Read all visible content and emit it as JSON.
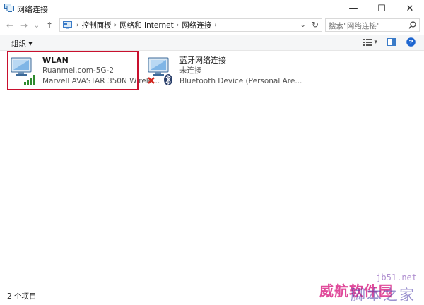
{
  "window": {
    "title": "网络连接",
    "minimize": "—",
    "maximize": "☐",
    "close": "✕"
  },
  "nav": {
    "back": "←",
    "forward": "→",
    "history": "⌄",
    "up": "↑",
    "breadcrumbs": [
      "控制面板",
      "网络和 Internet",
      "网络连接"
    ],
    "dropdown": "⌄",
    "refresh": "↻",
    "search_placeholder": "搜索\"网络连接\""
  },
  "toolbar": {
    "organize_label": "组织 ▾",
    "view_dropdown": "▾"
  },
  "connections": [
    {
      "name": "WLAN",
      "network": "Ruanmei.com-5G-2",
      "device": "Marvell AVASTAR 350N Wirele...",
      "icon": "wifi-adapter-icon",
      "status": "connected"
    },
    {
      "name": "蓝牙网络连接",
      "network": "未连接",
      "device": "Bluetooth Device (Personal Are...",
      "icon": "bluetooth-adapter-icon",
      "status": "disconnected"
    }
  ],
  "status": {
    "item_count": "2 个项目"
  },
  "watermark": {
    "url": "jb51.net",
    "line1": "威航软件园",
    "line2": "脚本之家"
  },
  "colors": {
    "selection_border": "#c8102e",
    "disconnected_x": "#d0261e",
    "signal": "#2e8b2e",
    "help": "#1e66d0"
  }
}
